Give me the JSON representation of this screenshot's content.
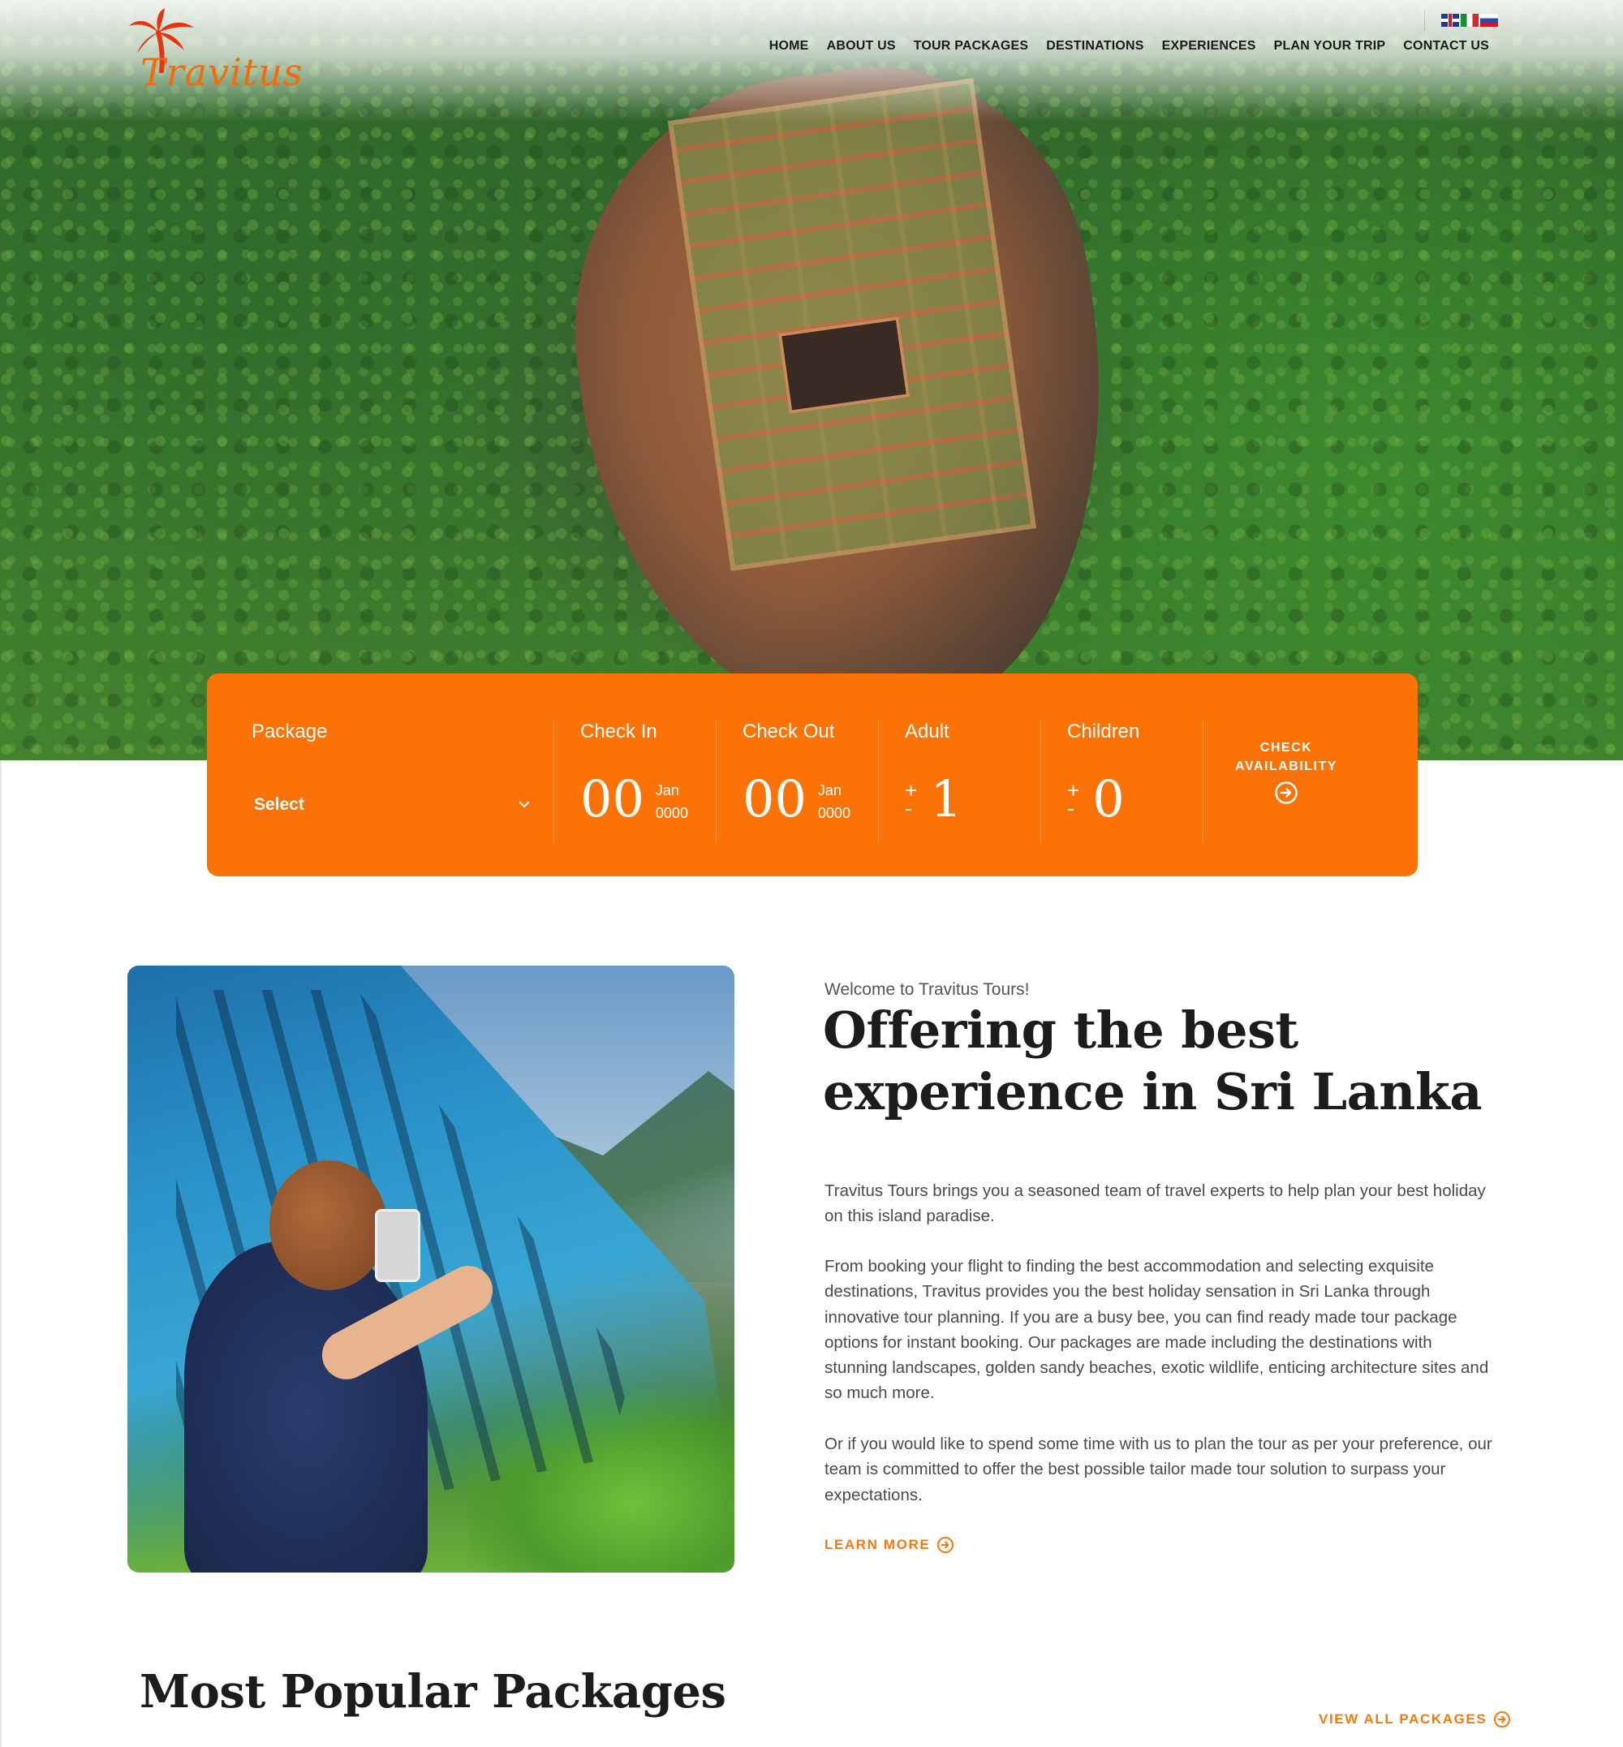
{
  "brand": {
    "logo_text": "Travitus",
    "accent_color": "#fb7306"
  },
  "nav": {
    "items": [
      {
        "label": "HOME"
      },
      {
        "label": "ABOUT US"
      },
      {
        "label": "TOUR PACKAGES"
      },
      {
        "label": "DESTINATIONS"
      },
      {
        "label": "EXPERIENCES"
      },
      {
        "label": "PLAN YOUR TRIP"
      },
      {
        "label": "CONTACT US"
      }
    ],
    "languages": [
      "uk-flag-icon",
      "italy-flag-icon",
      "russia-flag-icon"
    ]
  },
  "hero": {
    "image": "aerial-view-sigiriya-rock"
  },
  "booking": {
    "package_label": "Package",
    "package_value": "Select",
    "check_in_label": "Check In",
    "check_in_day": "00",
    "check_in_month": "Jan",
    "check_in_year": "0000",
    "check_out_label": "Check Out",
    "check_out_day": "00",
    "check_out_month": "Jan",
    "check_out_year": "0000",
    "adult_label": "Adult",
    "adult_value": "1",
    "children_label": "Children",
    "children_value": "0",
    "plus": "+",
    "minus": "-",
    "check_line1": "CHECK",
    "check_line2": "AVAILABILITY"
  },
  "about": {
    "image": "woman-photographing-from-train-window",
    "welcome": "Welcome to Travitus Tours!",
    "headline_line1": "Offering the best",
    "headline_line2": "experience in Sri Lanka",
    "p1": "Travitus Tours brings you a seasoned team of travel experts to help plan your best holiday on this island paradise.",
    "p2": "From booking your flight to finding the best accommodation and selecting exquisite destinations, Travitus provides you the best holiday sensation in Sri Lanka through innovative tour planning. If you are a busy bee, you can find ready made tour package options for instant booking. Our packages are made including the destinations with stunning landscapes, golden sandy beaches, exotic wildlife, enticing architecture sites and so much more.",
    "p3": "Or if you would like to spend some time with us to plan the tour as per your preference, our team is committed to offer the best possible tailor made tour solution to surpass your expectations.",
    "learn_more": "LEARN MORE"
  },
  "popular": {
    "title": "Most Popular Packages",
    "view_all": "VIEW ALL PACKAGES"
  }
}
